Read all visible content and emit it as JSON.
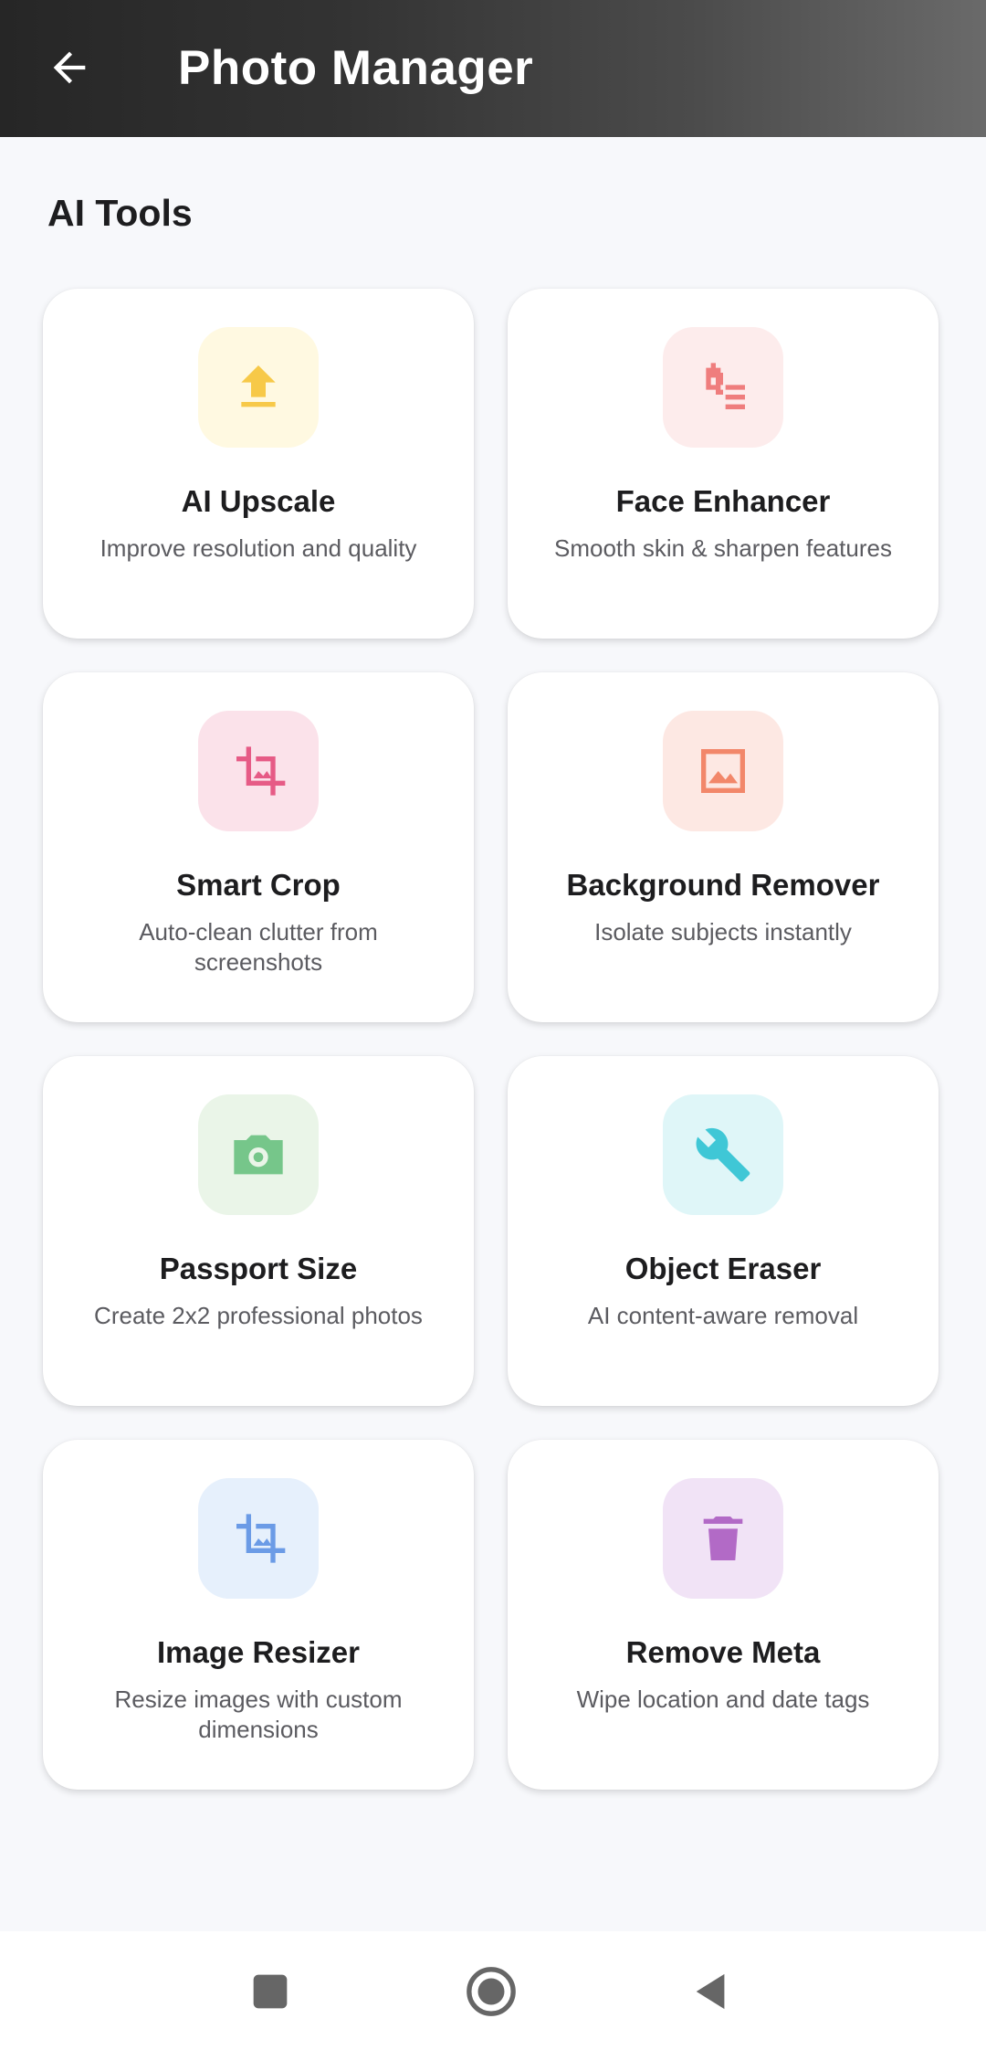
{
  "app_bar": {
    "title": "Photo Manager",
    "background_color": "#333333"
  },
  "section": {
    "title": "AI Tools"
  },
  "tools": [
    {
      "title": "AI Upscale",
      "description": "Improve resolution and quality",
      "icon": "upload-icon",
      "icon_color": "#f7c948",
      "icon_bg": "#fff9e1"
    },
    {
      "title": "Face Enhancer",
      "description": "Smooth skin & sharpen features",
      "icon": "face-filter-icon",
      "icon_color": "#ef7d7d",
      "icon_bg": "#fdecec"
    },
    {
      "title": "Smart Crop",
      "description": "Auto-clean clutter from screenshots",
      "icon": "crop-icon",
      "icon_color": "#e65b86",
      "icon_bg": "#fbe2ea"
    },
    {
      "title": "Background Remover",
      "description": "Isolate subjects instantly",
      "icon": "image-icon",
      "icon_color": "#f2876a",
      "icon_bg": "#fde8e3"
    },
    {
      "title": "Passport Size",
      "description": "Create 2x2 professional photos",
      "icon": "camera-icon",
      "icon_color": "#76c68a",
      "icon_bg": "#eaf5e8"
    },
    {
      "title": "Object Eraser",
      "description": "AI content-aware removal",
      "icon": "wrench-icon",
      "icon_color": "#3fc7d6",
      "icon_bg": "#dff6f8"
    },
    {
      "title": "Image Resizer",
      "description": "Resize images with custom dimensions",
      "icon": "crop-icon",
      "icon_color": "#6b9be6",
      "icon_bg": "#e6f0fc"
    },
    {
      "title": "Remove Meta",
      "description": "Wipe location and date tags",
      "icon": "trash-icon",
      "icon_color": "#b26ac6",
      "icon_bg": "#f1e3f6"
    }
  ],
  "nav": {
    "recents_icon": "square-icon",
    "home_icon": "circle-home-icon",
    "back_icon": "triangle-back-icon",
    "icon_color": "#666666"
  }
}
